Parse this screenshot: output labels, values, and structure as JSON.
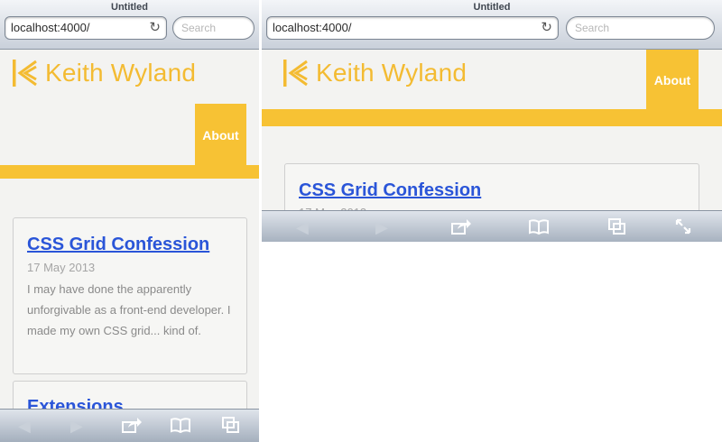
{
  "browser": {
    "title": "Untitled",
    "url": "localhost:4000/",
    "search_placeholder": "Search"
  },
  "site": {
    "name": "Keith Wyland",
    "nav_about": "About",
    "brand_color": "#f7c234"
  },
  "posts": [
    {
      "title": "CSS Grid Confession",
      "date": "17 May 2013",
      "excerpt": "I may have done the apparently unforgivable as a front-end developer. I made my own CSS grid... kind of."
    },
    {
      "title": "Extensions"
    }
  ],
  "toolbar_icons": [
    "back-arrow-icon",
    "forward-arrow-icon",
    "share-icon",
    "bookmarks-icon",
    "tabs-icon",
    "fullscreen-icon"
  ]
}
